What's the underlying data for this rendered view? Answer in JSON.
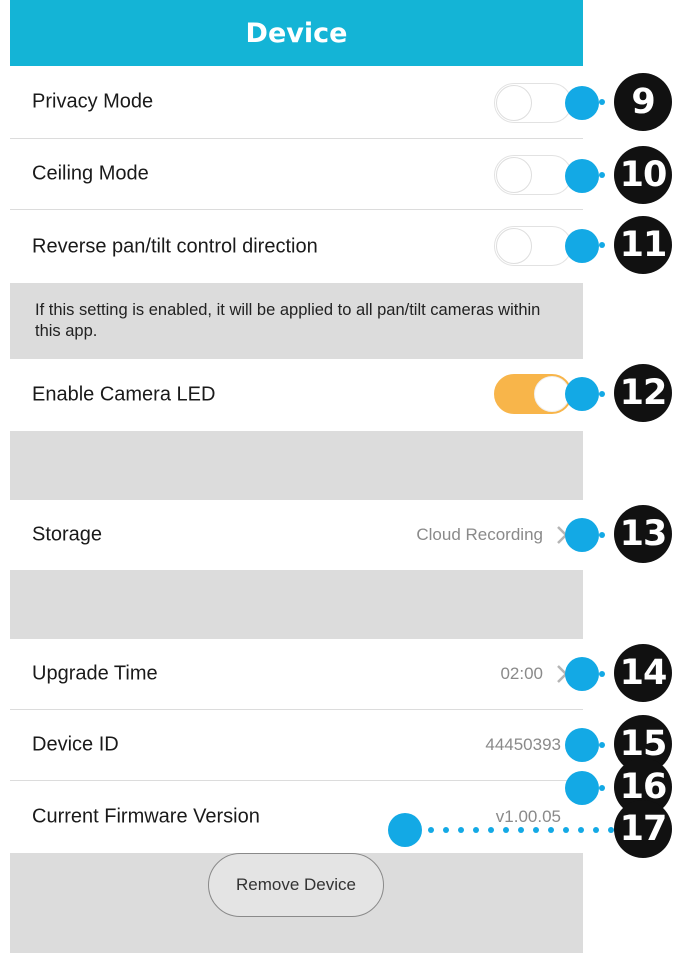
{
  "header": {
    "title": "Device"
  },
  "settings": {
    "privacy_mode": {
      "label": "Privacy Mode",
      "enabled": false
    },
    "ceiling_mode": {
      "label": "Ceiling Mode",
      "enabled": false
    },
    "reverse_pan_tilt": {
      "label": "Reverse pan/tilt control direction",
      "enabled": false,
      "note": "If this setting is enabled, it will be applied to all pan/tilt cameras within this app."
    },
    "camera_led": {
      "label": "Enable Camera LED",
      "enabled": true
    },
    "storage": {
      "label": "Storage",
      "value": "Cloud Recording"
    },
    "upgrade_time": {
      "label": "Upgrade Time",
      "value": "02:00"
    },
    "device_id": {
      "label": "Device ID",
      "value": "44450393"
    },
    "firmware": {
      "label": "Current Firmware Version",
      "value": "v1.00.05"
    }
  },
  "remove_button": {
    "label": "Remove Device"
  },
  "callouts": [
    "9",
    "10",
    "11",
    "12",
    "13",
    "14",
    "15",
    "16",
    "17"
  ],
  "colors": {
    "header": "#14b4d6",
    "toggle_on": "#f8b54a",
    "section_gray": "#dcdcdc",
    "callout_dot": "#13a9e5",
    "callout_badge": "#111111"
  },
  "icons": {
    "chevron": "chevron-right-icon"
  }
}
